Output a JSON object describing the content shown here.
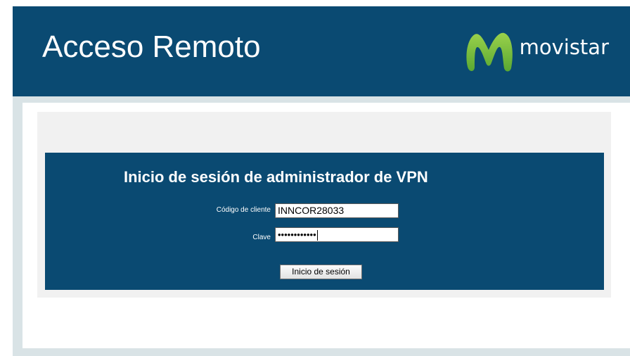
{
  "header": {
    "title": "Acceso Remoto",
    "brand_name": "movistar",
    "brand_logo_icon": "movistar-m-icon"
  },
  "login": {
    "heading": "Inicio de sesión de administrador de VPN",
    "client_code_label": "Código de cliente",
    "client_code_value": "INNCOR28033",
    "password_label": "Clave",
    "password_masked": "••••••••••••",
    "submit_label": "Inicio de sesión"
  },
  "colors": {
    "header_bg": "#0a4a72",
    "logo_green": "#7ac142"
  }
}
